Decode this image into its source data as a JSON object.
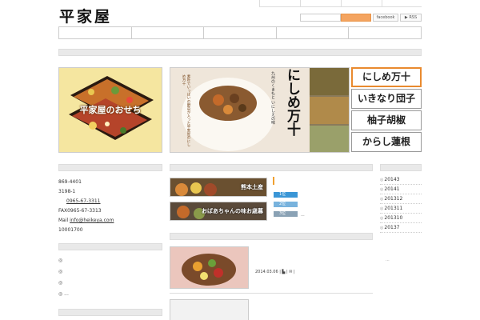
{
  "header": {
    "logo": "平家屋",
    "social": {
      "facebook": "facebook",
      "rss": "RSS"
    }
  },
  "hero": {
    "osechi_label": "平家屋のおせち",
    "product_title": "にしめ万十",
    "tagline": "九州のくまもと いにしえの味",
    "copy": "素朴でいっぱいの野菜が入った平家屋のにしめ万十"
  },
  "products": [
    {
      "label": "にしめ万十",
      "active": true
    },
    {
      "label": "いきなり団子",
      "active": false
    },
    {
      "label": "柚子胡椒",
      "active": false
    },
    {
      "label": "からし蓮根",
      "active": false
    }
  ],
  "contact": {
    "postal": "869-4401",
    "address": "3198-1",
    "tel": "0965-67-3311",
    "fax": "FAX0965-67-3313",
    "mail_label": "Mail",
    "mail": "info@heikeya.com",
    "hours": "10001700"
  },
  "left_list": {
    "items": [
      "◎",
      "◎",
      "◎"
    ],
    "last": "◎ ..."
  },
  "banners": [
    {
      "label": "熊本土産"
    },
    {
      "label": "おばあちゃんの味お歳暮"
    }
  ],
  "ranking": {
    "items": [
      "1位",
      "2位",
      "3位"
    ],
    "more": "..."
  },
  "post": {
    "date": "2014.03.06",
    "meta": "| ▙ | ✉ |"
  },
  "archive": {
    "items": [
      "20143",
      "20141",
      "201312",
      "201311",
      "201310",
      "20137"
    ],
    "more": "..."
  }
}
